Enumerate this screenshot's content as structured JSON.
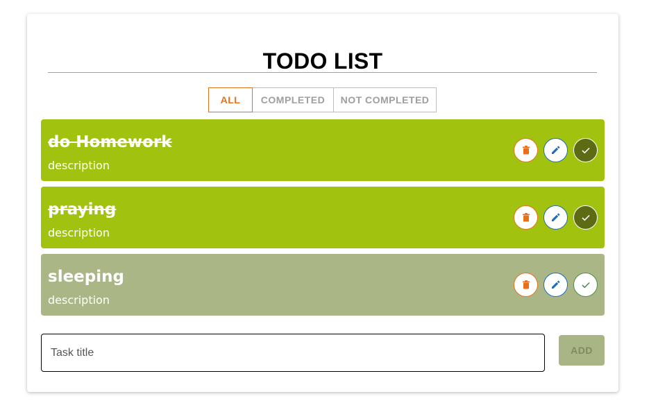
{
  "app": {
    "title": "TODO LIST"
  },
  "filters": {
    "all": "ALL",
    "completed": "COMPLETED",
    "not_completed": "NOT COMPLETED",
    "active": "ALL"
  },
  "tasks": [
    {
      "title": "do Homework",
      "description": "description",
      "completed": true
    },
    {
      "title": "praying",
      "description": "description",
      "completed": true
    },
    {
      "title": "sleeping",
      "description": "description",
      "completed": false
    }
  ],
  "input": {
    "placeholder": "Task title",
    "value": ""
  },
  "add_button": {
    "label": "ADD"
  },
  "colors": {
    "completed_bg": "#a1c30f",
    "pending_bg": "#abb686",
    "accent_orange": "#e8701a",
    "accent_blue": "#1e6bb8",
    "check_done_bg": "#5c6b14",
    "check_pending": "#4c8c4c",
    "add_button_bg": "#aab586"
  },
  "icons": {
    "delete": "trash-icon",
    "edit": "pencil-icon",
    "complete": "check-icon"
  }
}
